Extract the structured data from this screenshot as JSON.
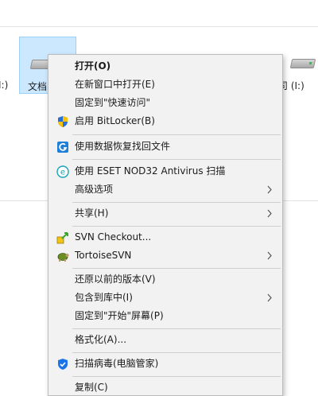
{
  "explorer": {
    "left_partial_label": "I:)",
    "selected_drive_label": "文档",
    "right_drive_label": "司 (I:)"
  },
  "menu": {
    "items": [
      {
        "label": "打开(O)",
        "bold": true,
        "icon": "",
        "submenu": false
      },
      {
        "label": "在新窗口中打开(E)",
        "bold": false,
        "icon": "",
        "submenu": false
      },
      {
        "label": "固定到\"快速访问\"",
        "bold": false,
        "icon": "",
        "submenu": false
      },
      {
        "label": "启用 BitLocker(B)",
        "bold": false,
        "icon": "uac-shield-icon",
        "submenu": false
      },
      {
        "label": "使用数据恢复找回文件",
        "bold": false,
        "icon": "data-recovery-icon",
        "submenu": false
      },
      {
        "label": "使用 ESET NOD32 Antivirus 扫描",
        "bold": false,
        "icon": "eset-icon",
        "submenu": false
      },
      {
        "label": "高级选项",
        "bold": false,
        "icon": "",
        "submenu": true
      },
      {
        "label": "共享(H)",
        "bold": false,
        "icon": "",
        "submenu": true
      },
      {
        "label": "SVN Checkout...",
        "bold": false,
        "icon": "svn-checkout-icon",
        "submenu": false
      },
      {
        "label": "TortoiseSVN",
        "bold": false,
        "icon": "tortoisesvn-icon",
        "submenu": true
      },
      {
        "label": "还原以前的版本(V)",
        "bold": false,
        "icon": "",
        "submenu": false
      },
      {
        "label": "包含到库中(I)",
        "bold": false,
        "icon": "",
        "submenu": true
      },
      {
        "label": "固定到\"开始\"屏幕(P)",
        "bold": false,
        "icon": "",
        "submenu": false
      },
      {
        "label": "格式化(A)...",
        "bold": false,
        "icon": "",
        "submenu": false
      },
      {
        "label": "扫描病毒(电脑管家)",
        "bold": false,
        "icon": "tencent-pc-manager-icon",
        "submenu": false
      },
      {
        "label": "复制(C)",
        "bold": false,
        "icon": "",
        "submenu": false
      }
    ]
  },
  "colors": {
    "menu_bg": "#f2f2f2",
    "selection_bg": "#cce8ff",
    "separator": "#cfcfcf"
  }
}
